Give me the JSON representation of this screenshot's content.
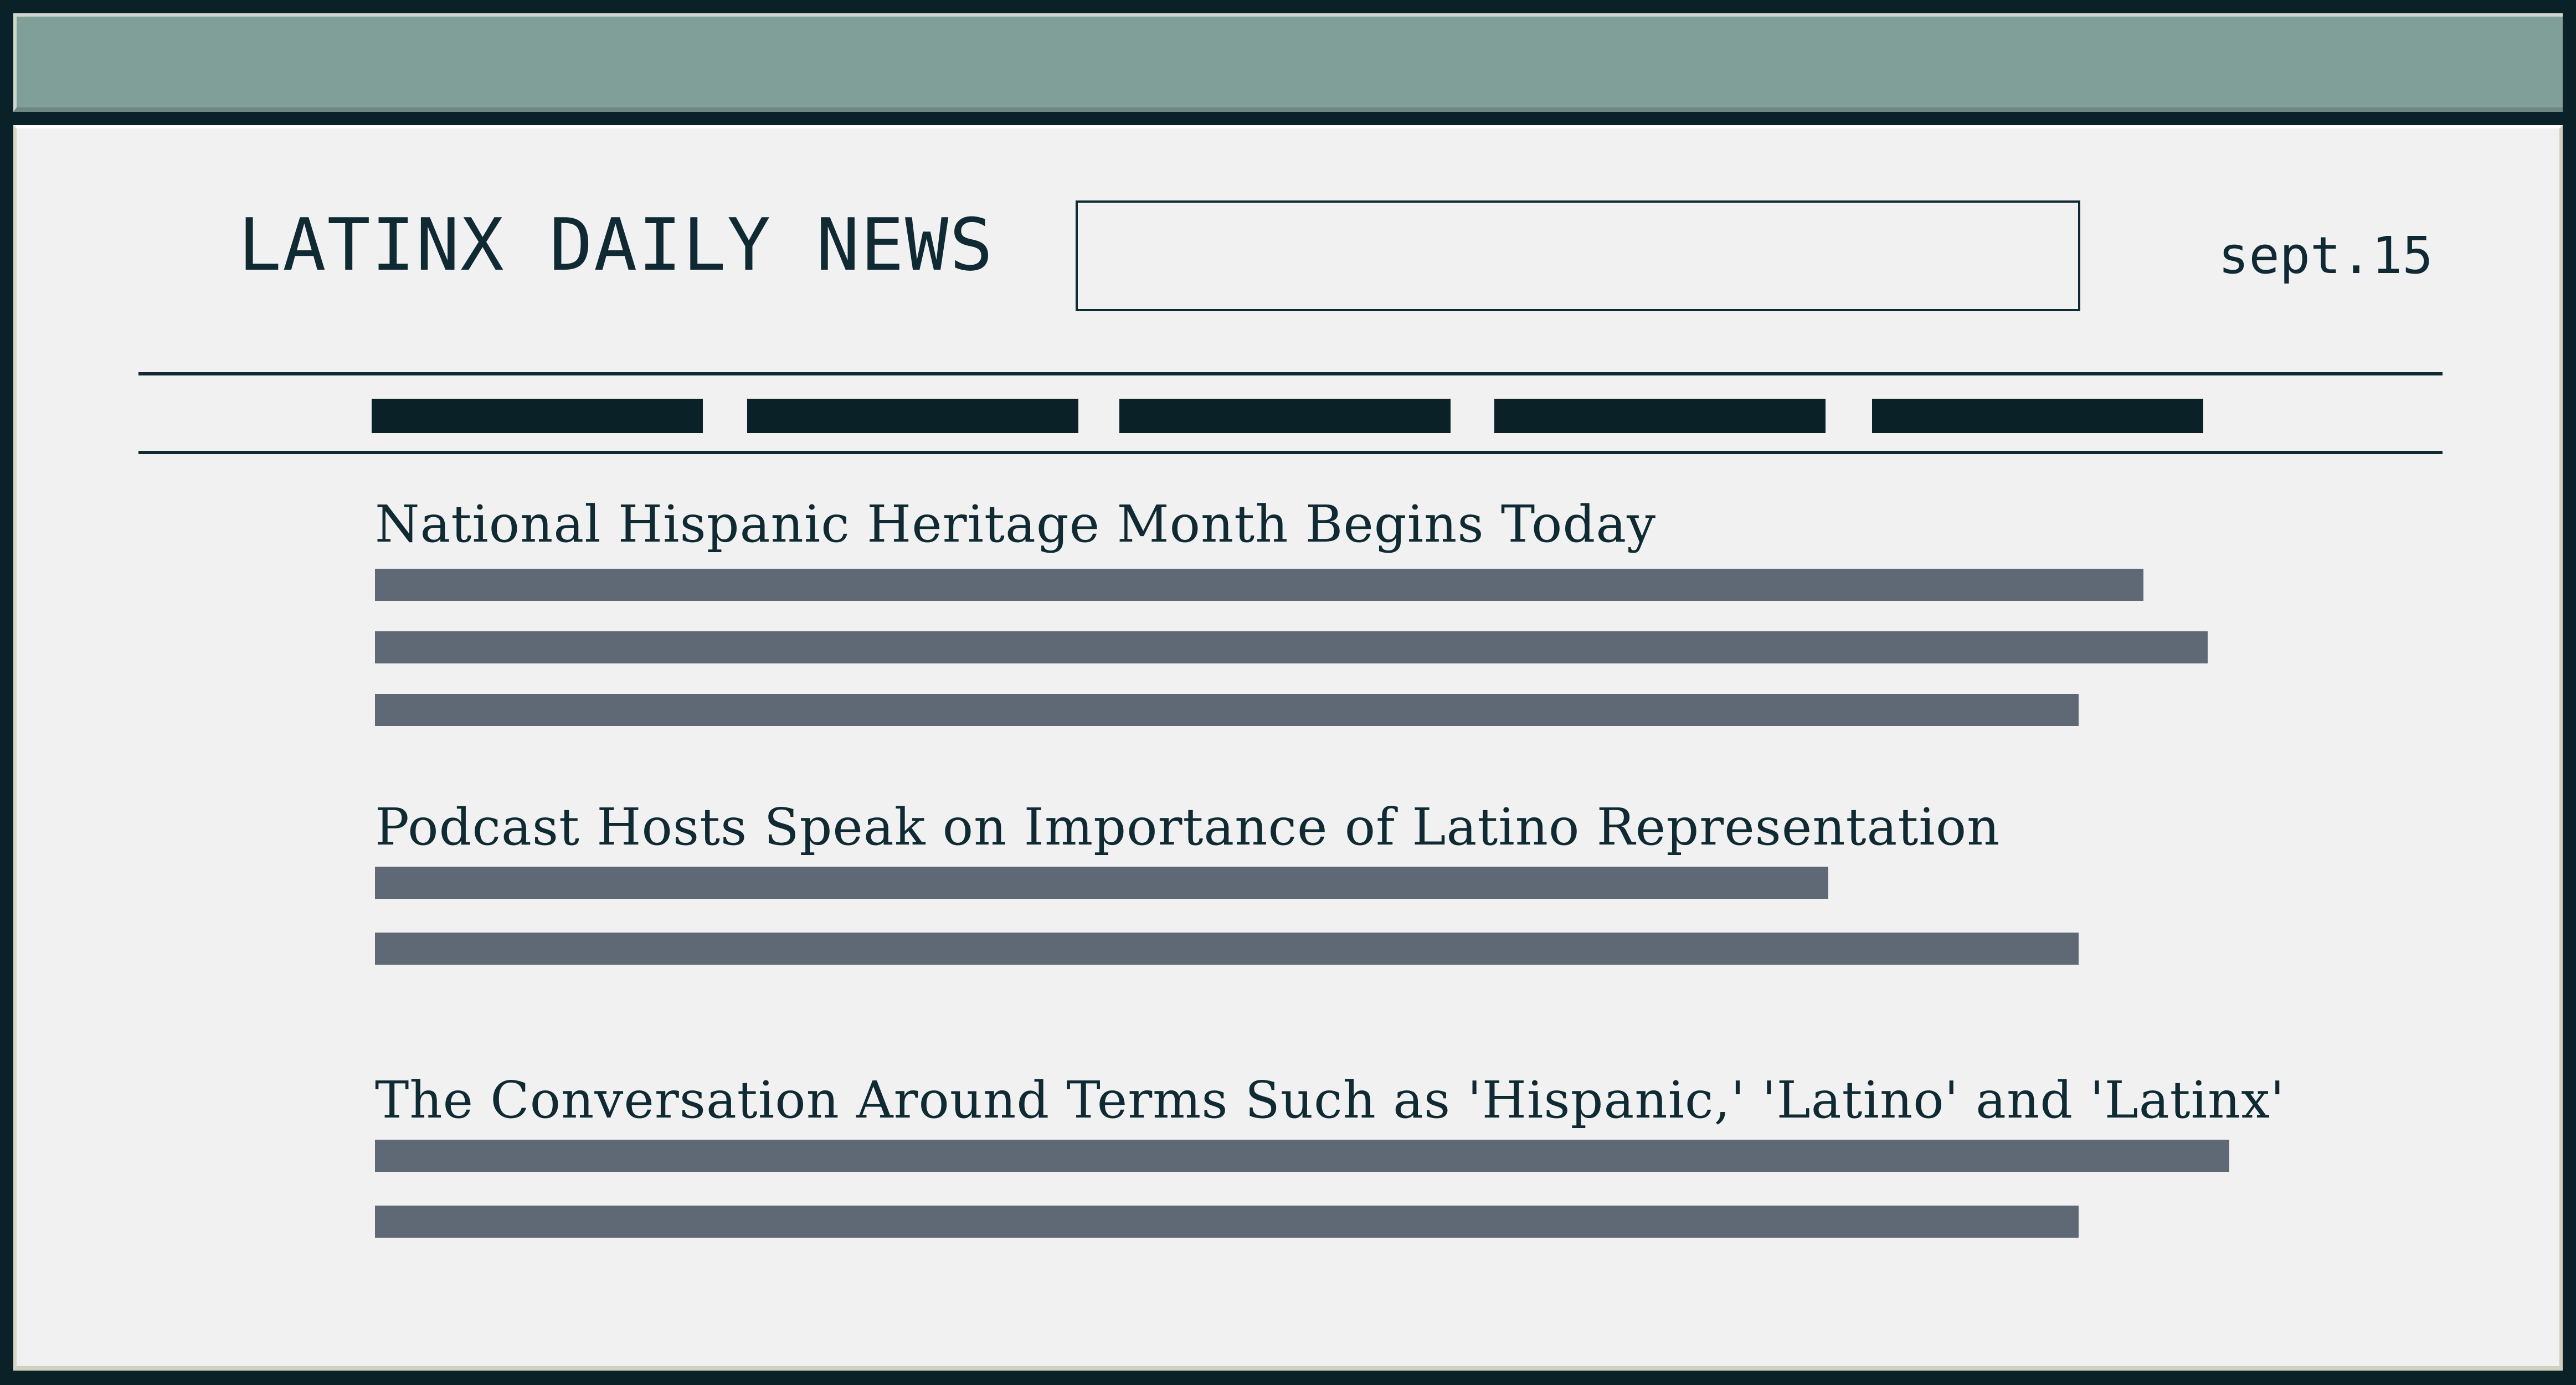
{
  "header": {
    "site_title": "LATINX DAILY NEWS",
    "search_value": "",
    "date": "sept.15"
  },
  "nav": {
    "items": [
      {
        "label": ""
      },
      {
        "label": ""
      },
      {
        "label": ""
      },
      {
        "label": ""
      },
      {
        "label": ""
      }
    ]
  },
  "articles": [
    {
      "headline": "National Hispanic Heritage Month Begins Today"
    },
    {
      "headline": "Podcast Hosts Speak on Importance of Latino Representation"
    },
    {
      "headline": "The Conversation Around Terms Such as 'Hispanic,' 'Latino' and 'Latinx'"
    }
  ],
  "colors": {
    "frame": "#0b2128",
    "titlebar": "#7f9f98",
    "page_background": "#f1f1f1",
    "text": "#0f2a33",
    "placeholder_text_bars": "#5f6975"
  }
}
